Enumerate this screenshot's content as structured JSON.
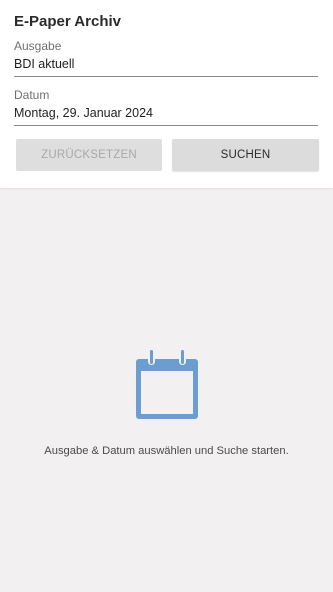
{
  "header": {
    "title": "E-Paper Archiv"
  },
  "form": {
    "edition_label": "Ausgabe",
    "edition_value": "BDI aktuell",
    "date_label": "Datum",
    "date_value": "Montag, 29. Januar 2024"
  },
  "buttons": {
    "reset_label": "ZURÜCKSETZEN",
    "search_label": "SUCHEN"
  },
  "empty_state": {
    "icon": "calendar-icon",
    "icon_color": "#6a9ed0",
    "message": "Ausgabe & Datum auswählen und Suche starten."
  }
}
